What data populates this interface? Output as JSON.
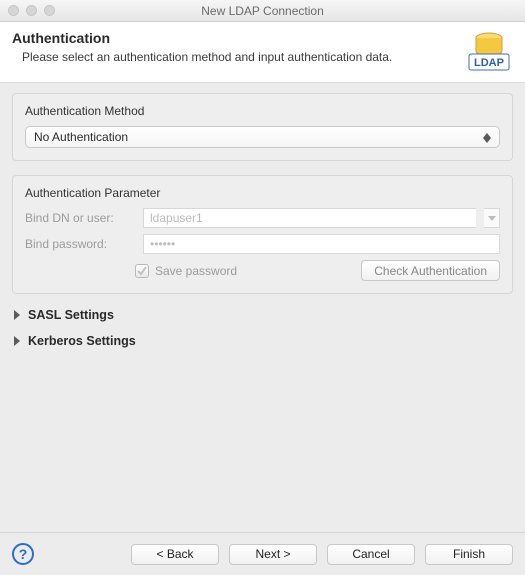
{
  "window": {
    "title": "New LDAP Connection"
  },
  "header": {
    "title": "Authentication",
    "subtitle": "Please select an authentication method and input authentication data.",
    "badge": "LDAP"
  },
  "method": {
    "label": "Authentication Method",
    "selected": "No Authentication"
  },
  "param": {
    "label": "Authentication Parameter",
    "bind_dn_label": "Bind DN or user:",
    "bind_dn_value": "ldapuser1",
    "bind_pw_label": "Bind password:",
    "bind_pw_placeholder": "••••••",
    "save_pw_label": "Save password",
    "check_btn": "Check Authentication"
  },
  "sections": {
    "sasl": "SASL Settings",
    "kerberos": "Kerberos Settings"
  },
  "footer": {
    "back": "< Back",
    "next": "Next >",
    "cancel": "Cancel",
    "finish": "Finish"
  }
}
